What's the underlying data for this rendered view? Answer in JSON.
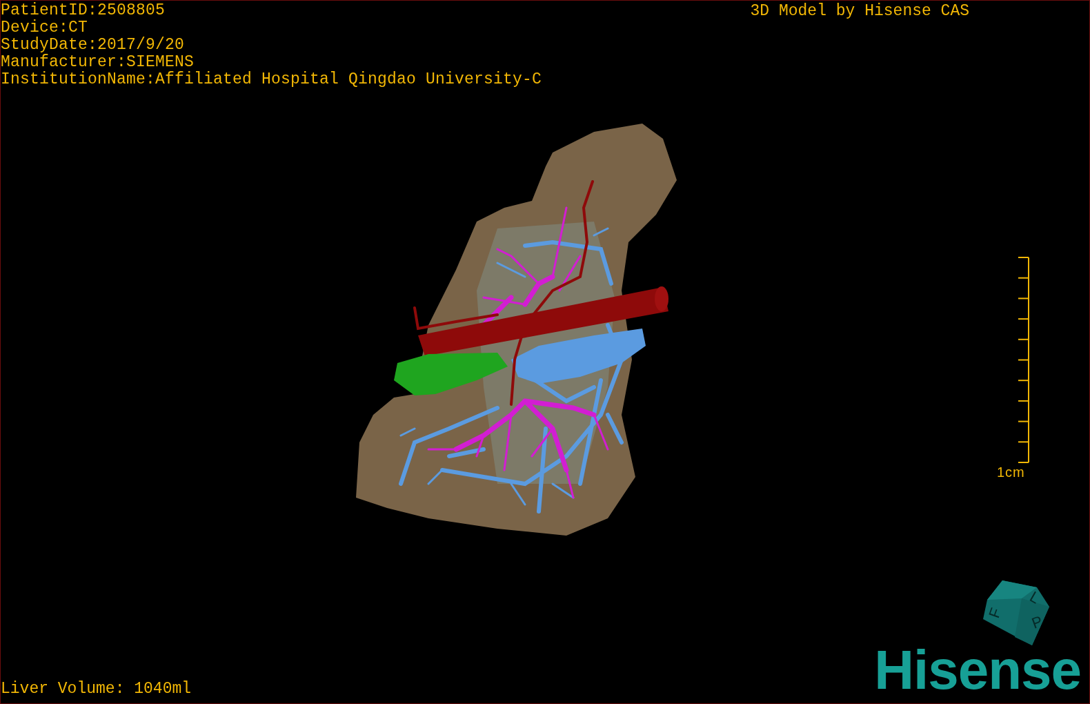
{
  "info_lines": [
    "PatientID:2508805",
    "Device:CT",
    "StudyDate:2017/9/20",
    "Manufacturer:SIEMENS",
    "InstitutionName:Affiliated Hospital Qingdao University-C"
  ],
  "title": "3D Model by Hisense CAS",
  "scale_bar": {
    "label": "1cm"
  },
  "orientation_cube": {
    "faces": [
      "F",
      "L",
      "P"
    ]
  },
  "liver_volume": "Liver Volume: 1040ml",
  "logo": "Hisense"
}
